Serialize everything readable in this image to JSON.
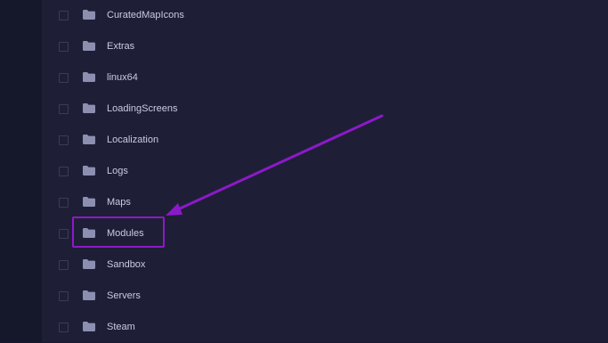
{
  "colors": {
    "background": "#1e1f36",
    "left_strip": "#15172b",
    "text": "#c9cbe0",
    "folder_icon": "#8c8fb0",
    "checkbox_border": "#3a3c58",
    "annotation": "#8c19c9"
  },
  "file_list": {
    "items": [
      {
        "name": "CuratedMapIcons",
        "icon": "folder-icon"
      },
      {
        "name": "Extras",
        "icon": "folder-icon"
      },
      {
        "name": "linux64",
        "icon": "folder-icon"
      },
      {
        "name": "LoadingScreens",
        "icon": "folder-icon"
      },
      {
        "name": "Localization",
        "icon": "folder-icon"
      },
      {
        "name": "Logs",
        "icon": "folder-icon"
      },
      {
        "name": "Maps",
        "icon": "folder-icon"
      },
      {
        "name": "Modules",
        "icon": "folder-icon",
        "highlighted": true
      },
      {
        "name": "Sandbox",
        "icon": "folder-icon"
      },
      {
        "name": "Servers",
        "icon": "folder-icon"
      },
      {
        "name": "Steam",
        "icon": "folder-icon"
      }
    ]
  }
}
